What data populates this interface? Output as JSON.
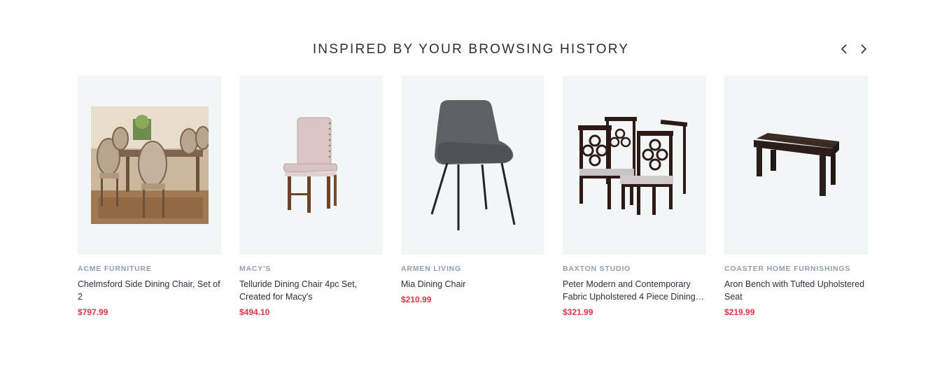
{
  "section": {
    "title": "INSPIRED BY YOUR BROWSING HISTORY",
    "prev_icon": "chevron-left-icon",
    "next_icon": "chevron-right-icon"
  },
  "products": [
    {
      "brand": "ACME FURNITURE",
      "name": "Chelmsford Side Dining Chair, Set of 2",
      "price": "$797.99",
      "image": "dining-room-photo"
    },
    {
      "brand": "MACY'S",
      "name": "Telluride Dining Chair 4pc Set, Created for Macy's",
      "price": "$494.10",
      "image": "upholstered-chair"
    },
    {
      "brand": "ARMEN LIVING",
      "name": "Mia Dining Chair",
      "price": "$210.99",
      "image": "gray-modern-chair"
    },
    {
      "brand": "BAXTON STUDIO",
      "name": "Peter Modern and Contemporary Fabric Upholstered 4 Piece Dining…",
      "price": "$321.99",
      "image": "four-dining-chairs"
    },
    {
      "brand": "COASTER HOME FURNISHINGS",
      "name": "Aron Bench with Tufted Upholstered Seat",
      "price": "$219.99",
      "image": "dark-bench"
    }
  ],
  "colors": {
    "price": "#e0334a",
    "brand": "#8f9fb0",
    "card_bg": "#f3f6f7"
  }
}
